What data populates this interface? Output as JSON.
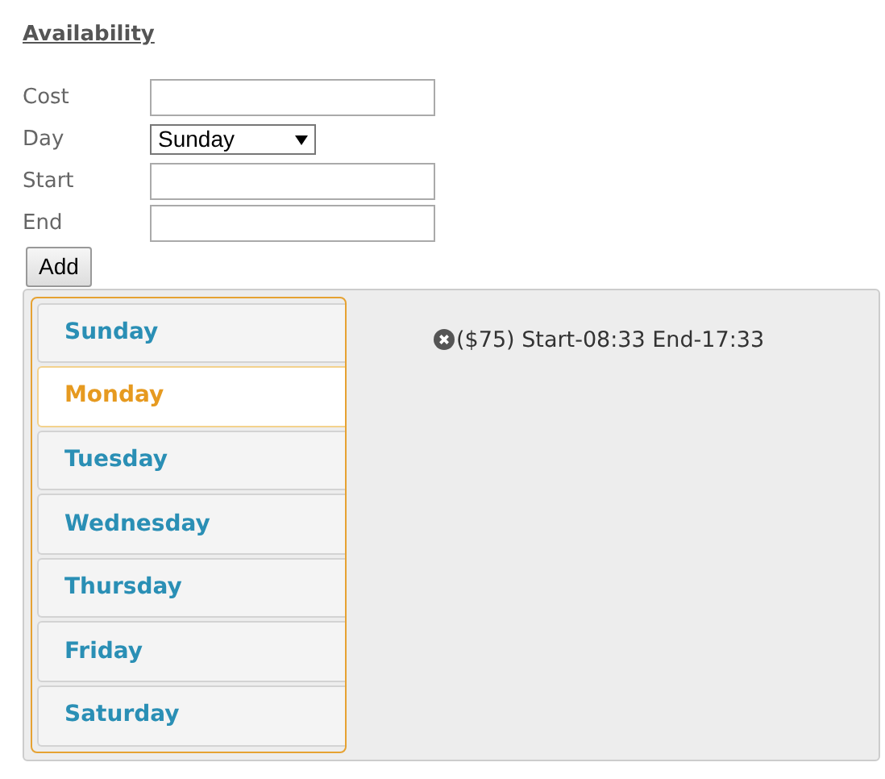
{
  "heading": "Availability",
  "form": {
    "fields": [
      {
        "label": "Cost",
        "kind": "text"
      },
      {
        "label": "Day",
        "kind": "select",
        "value": "Sunday"
      },
      {
        "label": "Start",
        "kind": "text"
      },
      {
        "label": "End",
        "kind": "text"
      }
    ],
    "button": "Add"
  },
  "tabs": [
    {
      "label": "Sunday",
      "selected": false
    },
    {
      "label": "Monday",
      "selected": true
    },
    {
      "label": "Tuesday",
      "selected": false
    },
    {
      "label": "Wednesday",
      "selected": false
    },
    {
      "label": "Thursday",
      "selected": false
    },
    {
      "label": "Friday",
      "selected": false
    },
    {
      "label": "Saturday",
      "selected": false
    }
  ],
  "entries": [
    {
      "text": "($75) Start-08:33 End-17:33"
    }
  ]
}
